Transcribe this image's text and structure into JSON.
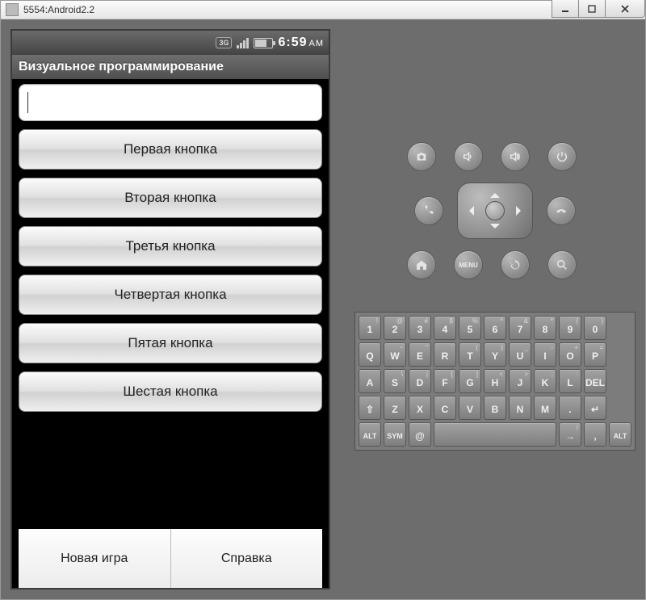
{
  "window": {
    "title": "5554:Android2.2"
  },
  "statusbar": {
    "threeg": "3G",
    "time": "6:59",
    "ampm": "AM"
  },
  "app": {
    "title": "Визуальное программирование",
    "input_value": "",
    "buttons": [
      "Первая кнопка",
      "Вторая кнопка",
      "Третья кнопка",
      "Четвертая кнопка",
      "Пятая кнопка",
      "Шестая кнопка"
    ],
    "menu": {
      "left": "Новая игра",
      "right": "Справка"
    }
  },
  "hw_buttons": {
    "row1": [
      "camera",
      "vol-down",
      "vol-up",
      "power"
    ],
    "row2": [
      "call",
      "dpad",
      "end-call"
    ],
    "row3": [
      "home",
      "menu",
      "back",
      "search"
    ],
    "menu_label": "MENU"
  },
  "keyboard": {
    "row1": [
      {
        "m": "1",
        "s": "!"
      },
      {
        "m": "2",
        "s": "@"
      },
      {
        "m": "3",
        "s": "#"
      },
      {
        "m": "4",
        "s": "$"
      },
      {
        "m": "5",
        "s": "%"
      },
      {
        "m": "6",
        "s": "^"
      },
      {
        "m": "7",
        "s": "&"
      },
      {
        "m": "8",
        "s": "*"
      },
      {
        "m": "9",
        "s": "("
      },
      {
        "m": "0",
        "s": ")"
      }
    ],
    "row2": [
      {
        "m": "Q",
        "s": ""
      },
      {
        "m": "W",
        "s": "~"
      },
      {
        "m": "E",
        "s": "\""
      },
      {
        "m": "R",
        "s": "`"
      },
      {
        "m": "T",
        "s": "{"
      },
      {
        "m": "Y",
        "s": "}"
      },
      {
        "m": "U",
        "s": "_"
      },
      {
        "m": "I",
        "s": "-"
      },
      {
        "m": "O",
        "s": "+"
      },
      {
        "m": "P",
        "s": "="
      }
    ],
    "row3": [
      {
        "m": "A",
        "s": ""
      },
      {
        "m": "S",
        "s": "\\"
      },
      {
        "m": "D",
        "s": "|"
      },
      {
        "m": "F",
        "s": "["
      },
      {
        "m": "G",
        "s": "]"
      },
      {
        "m": "H",
        "s": "<"
      },
      {
        "m": "J",
        "s": ">"
      },
      {
        "m": "K",
        "s": ";"
      },
      {
        "m": "L",
        "s": ":"
      },
      {
        "m": "DEL",
        "s": "",
        "name": "delete"
      }
    ],
    "row4": [
      {
        "m": "⇧",
        "s": "",
        "name": "shift"
      },
      {
        "m": "Z",
        "s": ""
      },
      {
        "m": "X",
        "s": ""
      },
      {
        "m": "C",
        "s": ""
      },
      {
        "m": "V",
        "s": ""
      },
      {
        "m": "B",
        "s": ""
      },
      {
        "m": "N",
        "s": ""
      },
      {
        "m": "M",
        "s": ""
      },
      {
        "m": ".",
        "s": ""
      },
      {
        "m": "↵",
        "s": "",
        "name": "enter"
      }
    ],
    "row5": [
      {
        "m": "ALT",
        "s": "",
        "name": "alt-left",
        "w": "small-txt"
      },
      {
        "m": "SYM",
        "s": "",
        "name": "sym",
        "w": "small-txt"
      },
      {
        "m": "@",
        "s": "",
        "name": "at"
      },
      {
        "m": "",
        "s": "",
        "name": "space",
        "w": "wide3"
      },
      {
        "m": "→",
        "s": "/",
        "name": "slash"
      },
      {
        "m": ",",
        "s": "",
        "name": "comma"
      },
      {
        "m": "ALT",
        "s": "",
        "name": "alt-right",
        "w": "small-txt"
      }
    ]
  }
}
